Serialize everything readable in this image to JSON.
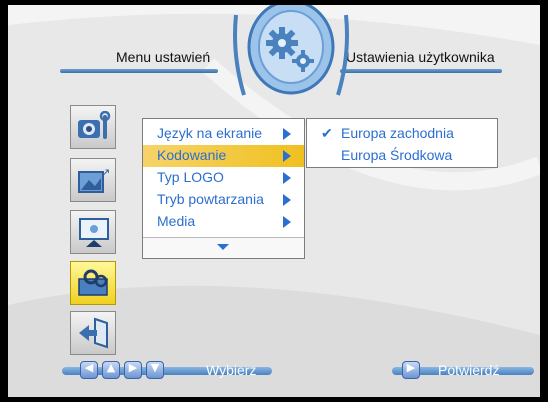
{
  "header": {
    "left_title": "Menu ustawień",
    "right_title": "Ustawienia użytkownika"
  },
  "sidebar": {
    "items": [
      {
        "icon": "camera-settings-icon",
        "active": false
      },
      {
        "icon": "image-adjust-icon",
        "active": false
      },
      {
        "icon": "slideshow-screen-icon",
        "active": false
      },
      {
        "icon": "user-settings-icon",
        "active": true
      },
      {
        "icon": "exit-door-icon",
        "active": false
      }
    ]
  },
  "menu": {
    "items": [
      {
        "label": "Język na ekranie"
      },
      {
        "label": "Kodowanie"
      },
      {
        "label": "Typ LOGO"
      },
      {
        "label": "Tryb powtarzania"
      },
      {
        "label": "Media"
      }
    ],
    "selected_index": 1
  },
  "submenu": {
    "items": [
      {
        "label": "Europa zachodnia",
        "checked": true,
        "check": "✔"
      },
      {
        "label": "Europa Środkowa",
        "checked": false,
        "check": ""
      }
    ]
  },
  "footer": {
    "select_label": "Wybierz",
    "confirm_label": "Potwierdź",
    "nav_buttons": [
      "arrow-left-icon",
      "arrow-up-icon",
      "arrow-right-icon",
      "arrow-down-icon"
    ]
  },
  "colors": {
    "menu_text": "#2b6fd0",
    "highlight": "#f0c020",
    "panel_bg": "#e8e8e8",
    "accent_blue": "#4a82c0"
  }
}
